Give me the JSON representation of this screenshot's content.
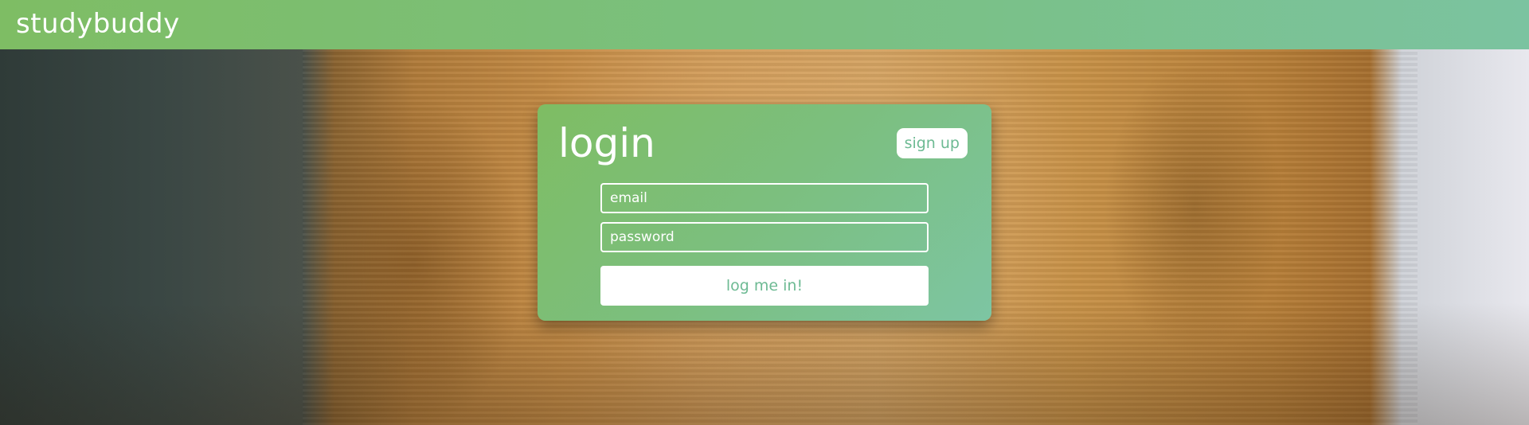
{
  "header": {
    "brand": "studybuddy"
  },
  "background": {
    "image": "person-in-mustard-knit-sweater-photo"
  },
  "login_card": {
    "title": "login",
    "signup_label": "sign up",
    "email": {
      "placeholder": "email",
      "value": ""
    },
    "password": {
      "placeholder": "password",
      "value": ""
    },
    "submit_label": "log me in!"
  },
  "colors": {
    "accent_green": "#7ebd63",
    "accent_teal": "#7dc5a3",
    "button_text": "#6dba93",
    "white": "#ffffff"
  }
}
